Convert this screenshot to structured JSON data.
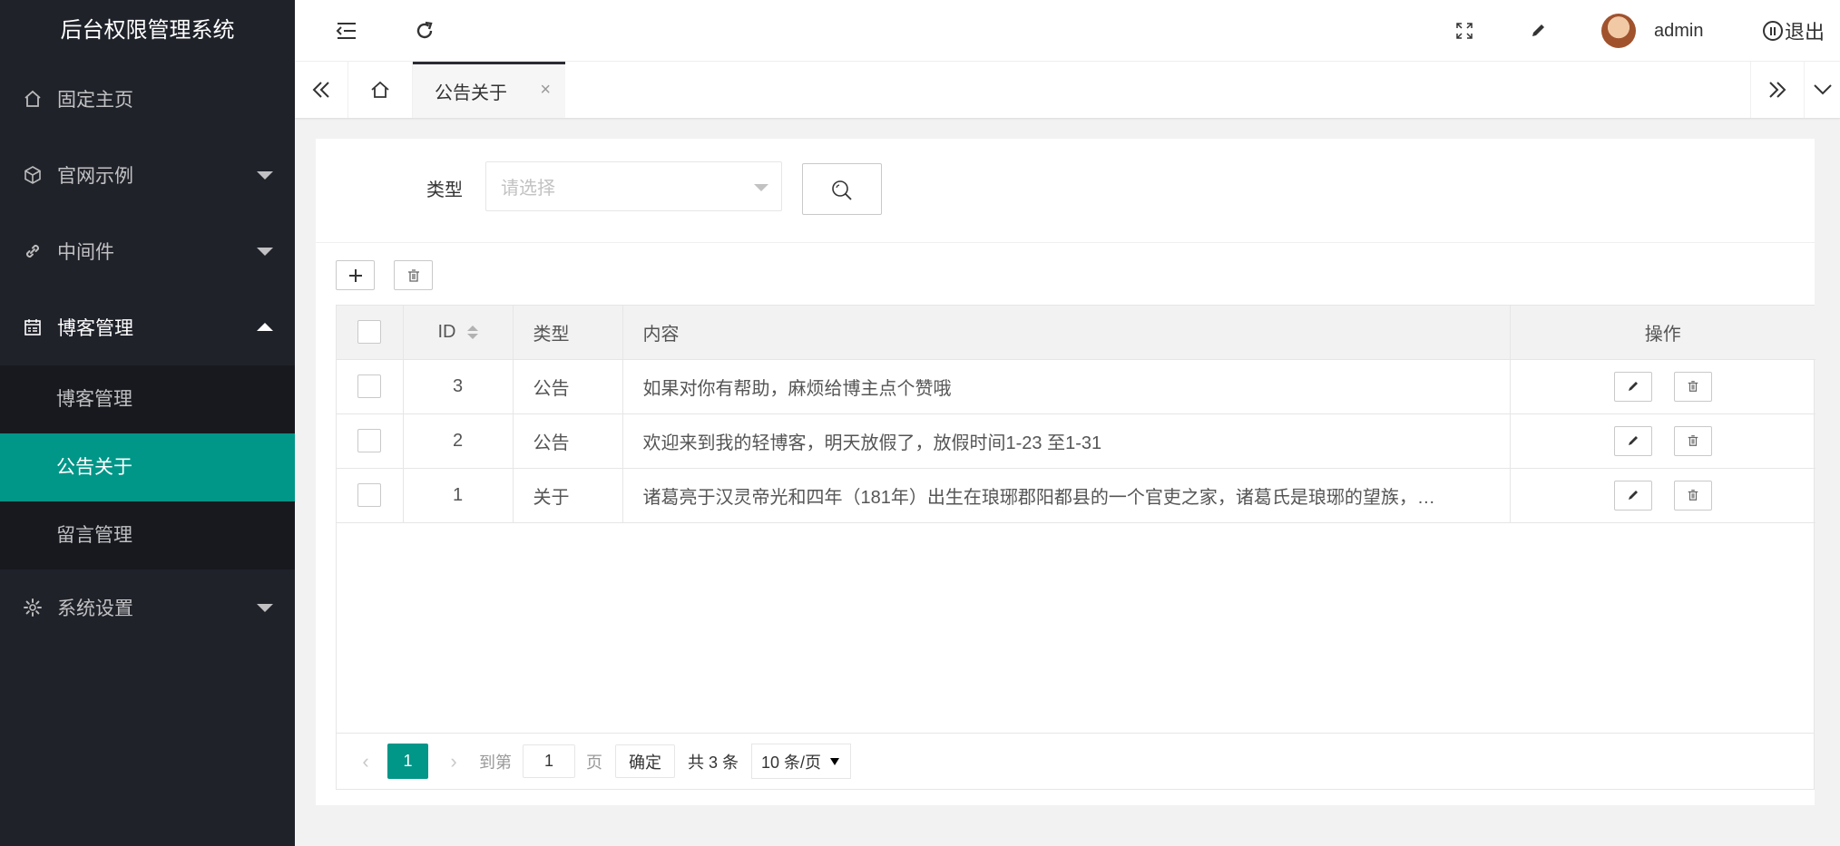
{
  "app": {
    "title": "后台权限管理系统"
  },
  "sidebar": {
    "items": [
      {
        "label": "固定主页",
        "icon": "home-icon"
      },
      {
        "label": "官网示例",
        "icon": "cube-icon"
      },
      {
        "label": "中间件",
        "icon": "link-icon"
      },
      {
        "label": "博客管理",
        "icon": "calendar-icon",
        "expanded": true
      },
      {
        "label": "系统设置",
        "icon": "gear-icon"
      }
    ],
    "subitems": [
      {
        "label": "博客管理"
      },
      {
        "label": "公告关于",
        "active": true
      },
      {
        "label": "留言管理"
      }
    ]
  },
  "header": {
    "username": "admin",
    "logout_label": "退出"
  },
  "tabs": {
    "current": "公告关于"
  },
  "search": {
    "type_label": "类型",
    "type_placeholder": "请选择"
  },
  "table": {
    "columns": [
      "ID",
      "类型",
      "内容",
      "操作"
    ],
    "rows": [
      {
        "id": "3",
        "type": "公告",
        "content": "如果对你有帮助，麻烦给博主点个赞哦"
      },
      {
        "id": "2",
        "type": "公告",
        "content": "欢迎来到我的轻博客，明天放假了，放假时间1-23 至1-31"
      },
      {
        "id": "1",
        "type": "关于",
        "content": "诸葛亮于汉灵帝光和四年（181年）出生在琅琊郡阳都县的一个官吏之家，诸葛氏是琅琊的望族，…"
      }
    ]
  },
  "pager": {
    "current_page": "1",
    "goto_label": "到第",
    "goto_value": "1",
    "page_unit": "页",
    "confirm_label": "确定",
    "total_text": "共 3 条",
    "page_size": "10 条/页"
  },
  "colors": {
    "accent": "#009688",
    "sidebar_bg": "#20222a",
    "sidebar_sub_bg": "#17191f"
  }
}
